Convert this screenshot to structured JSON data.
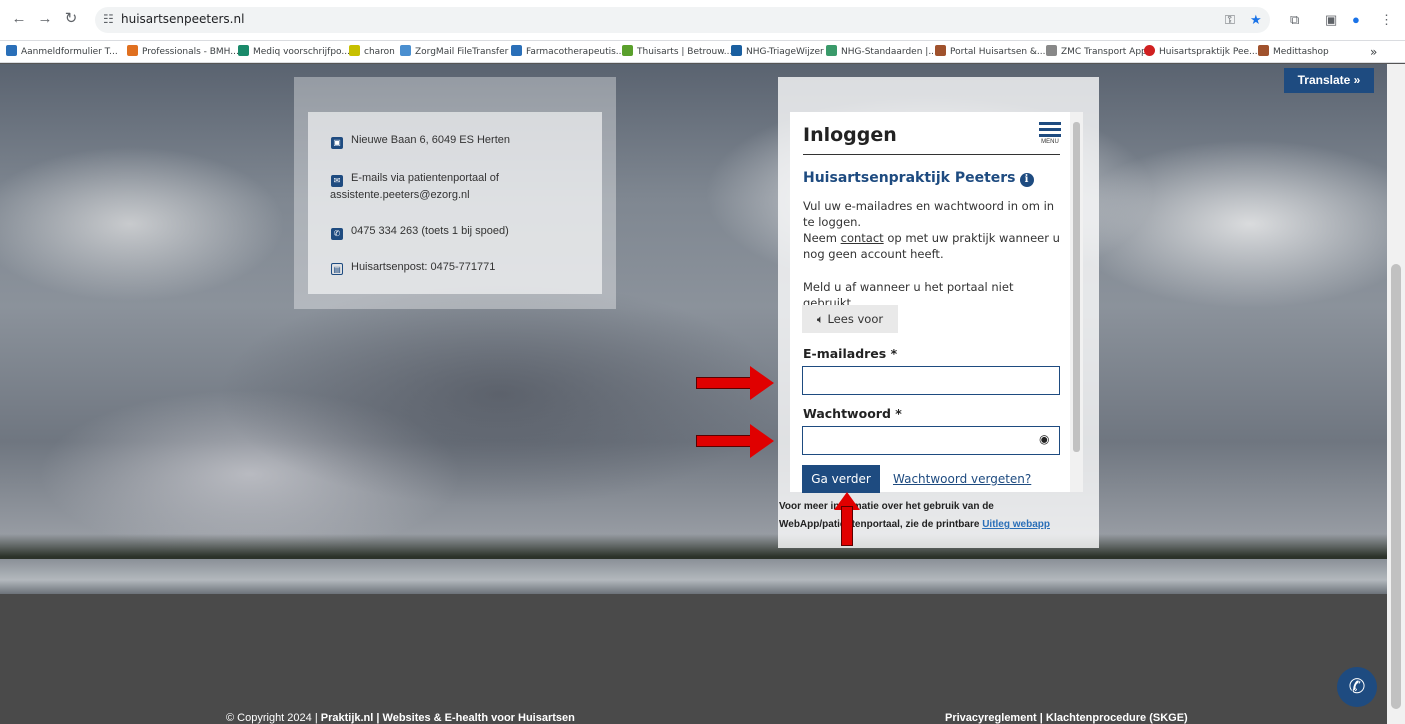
{
  "browser": {
    "url": "huisartsenpeeters.nl",
    "bookmarks": [
      {
        "label": "Aanmeldformulier T...",
        "color": "#2a6fb8"
      },
      {
        "label": "Professionals - BMH...",
        "color": "#e07020"
      },
      {
        "label": "Mediq voorschrijfpo...",
        "color": "#1a8a6a"
      },
      {
        "label": "charon",
        "color": "#c7c000"
      },
      {
        "label": "ZorgMail FileTransfer",
        "color": "#4a8fd0"
      },
      {
        "label": "Farmacotherapeutis...",
        "color": "#2a6fb8"
      },
      {
        "label": "Thuisarts | Betrouw...",
        "color": "#5aa02c"
      },
      {
        "label": "NHG-TriageWijzer",
        "color": "#1a5fa0"
      },
      {
        "label": "NHG-Standaarden |...",
        "color": "#3a9a6a"
      },
      {
        "label": "Portal Huisartsen &...",
        "color": "#a0522d"
      },
      {
        "label": "ZMC Transport App",
        "color": "#888888"
      },
      {
        "label": "Huisartspraktijk Pee...",
        "color": "#d02020"
      },
      {
        "label": "Medittashop",
        "color": "#a0522d"
      }
    ],
    "more": "»"
  },
  "translate": {
    "label": "Translate »"
  },
  "contact": {
    "address": "Nieuwe Baan 6, 6049 ES Herten",
    "email_line1": "E-mails via patientenportaal of",
    "email_line2": "assistente.peeters@ezorg.nl",
    "phone": "0475 334 263 (toets 1 bij spoed)",
    "huisartsenpost": "Huisartsenpost: 0475-771771"
  },
  "login": {
    "title": "Inloggen",
    "menu_label": "MENU",
    "practice": "Huisartsenpraktijk Peeters",
    "intro_line1": "Vul uw e-mailadres en wachtwoord in om in te loggen.",
    "intro_pre": "Neem ",
    "intro_link": "contact",
    "intro_post": " op met uw praktijk wanneer u nog geen account heeft.",
    "logout_note": "Meld u af wanneer u het portaal niet gebruikt.",
    "read_aloud": "Lees voor",
    "email_label": "E-mailadres *",
    "email_value": "",
    "password_label": "Wachtwoord *",
    "password_value": "",
    "submit": "Ga verder",
    "forgot": "Wachtwoord vergeten?"
  },
  "more_info": {
    "line1": "Voor meer informatie over het gebruik van de",
    "line2_pre": "WebApp/patiëntenportaal, zie de printbare ",
    "line2_link": "Uitleg webapp"
  },
  "footer": {
    "copyright_pre": "© Copyright 2024 | ",
    "copyright_bold": "Praktijk.nl | Websites & E-health voor Huisartsen",
    "right": "Privacyreglement | Klachtenprocedure (SKGE)"
  },
  "colors": {
    "brand": "#1e4b80",
    "annotation": "#e00000"
  }
}
